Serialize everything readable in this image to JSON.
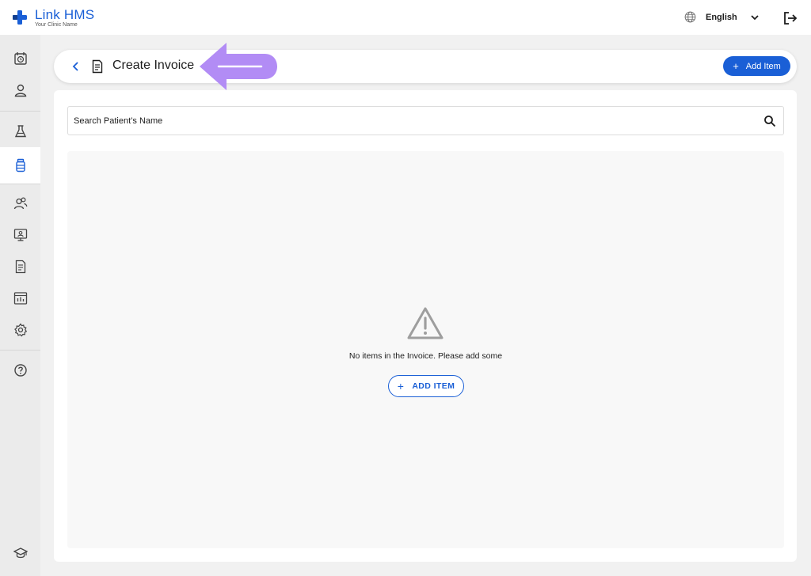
{
  "brand": {
    "name": "Link HMS",
    "subtitle": "Your Clinic Name",
    "color": "#1a5fd6"
  },
  "topbar": {
    "language": "English",
    "icons": [
      "globe-icon",
      "chevron-down-icon",
      "logout-icon"
    ]
  },
  "sidebar": {
    "items": [
      {
        "name": "appointments",
        "icon": "calendar-clock-icon",
        "active": false
      },
      {
        "name": "patients",
        "icon": "user-icon",
        "active": false
      },
      {
        "name": "lab",
        "icon": "flask-icon",
        "active": false
      },
      {
        "name": "pharmacy",
        "icon": "medicine-bottle-icon",
        "active": true
      },
      {
        "name": "staff",
        "icon": "users-icon",
        "active": false
      },
      {
        "name": "doctor",
        "icon": "monitor-user-icon",
        "active": false
      },
      {
        "name": "invoices",
        "icon": "document-icon",
        "active": false
      },
      {
        "name": "reports",
        "icon": "chart-icon",
        "active": false
      },
      {
        "name": "settings",
        "icon": "gear-icon",
        "active": false
      },
      {
        "name": "help",
        "icon": "help-icon",
        "active": false
      },
      {
        "name": "training",
        "icon": "graduation-cap-icon",
        "active": false
      }
    ]
  },
  "header": {
    "title": "Create Invoice",
    "add_button_label": "Add Item",
    "add_button_plus": "+"
  },
  "search": {
    "placeholder": "Search Patient’s Name",
    "value": ""
  },
  "empty_state": {
    "message": "No items in the Invoice. Please add some",
    "button_label": "ADD ITEM",
    "button_plus": "+"
  },
  "colors": {
    "accent": "#1a5fd6",
    "annotation": "#b28cf5",
    "warning_icon": "#9e9e9e"
  }
}
